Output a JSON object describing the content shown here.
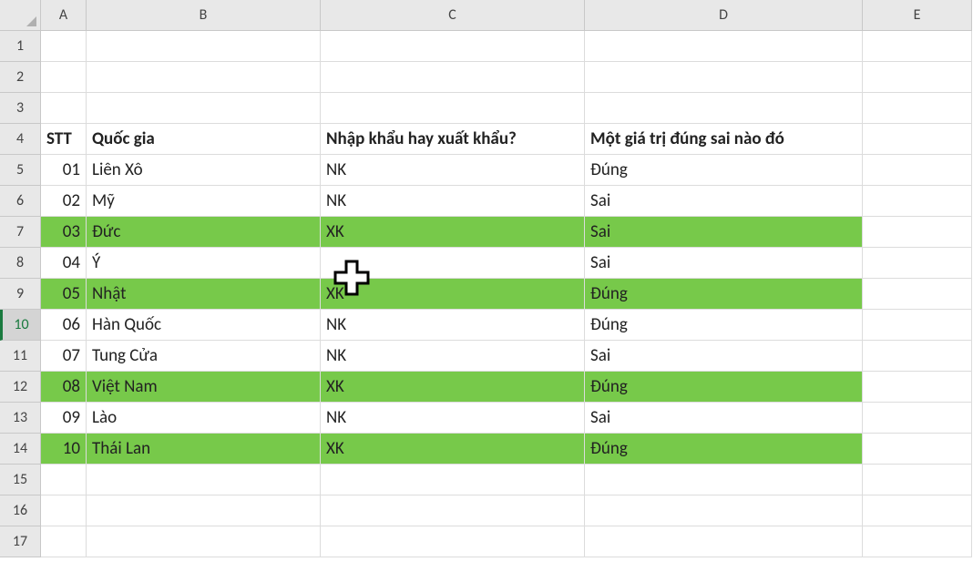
{
  "columns": [
    "A",
    "B",
    "C",
    "D",
    "E"
  ],
  "rowNumbers": [
    "1",
    "2",
    "3",
    "4",
    "5",
    "6",
    "7",
    "8",
    "9",
    "10",
    "11",
    "12",
    "13",
    "14",
    "15",
    "16",
    "17"
  ],
  "selectedRow": 10,
  "header": {
    "stt": "STT",
    "quocGia": "Quốc gia",
    "nhapXuat": "Nhập khẩu hay xuất khẩu?",
    "dungSai": "Một giá trị đúng sai nào đó"
  },
  "rows": [
    {
      "r": 5,
      "stt": "01",
      "quocGia": "Liên Xô",
      "nx": "NK",
      "ds": "Đúng",
      "hl": false
    },
    {
      "r": 6,
      "stt": "02",
      "quocGia": "Mỹ",
      "nx": "NK",
      "ds": "Sai",
      "hl": false
    },
    {
      "r": 7,
      "stt": "03",
      "quocGia": "Đức",
      "nx": "XK",
      "ds": "Sai",
      "hl": true
    },
    {
      "r": 8,
      "stt": "04",
      "quocGia": "Ý",
      "nx": "",
      "ds": "Sai",
      "hl": false
    },
    {
      "r": 9,
      "stt": "05",
      "quocGia": "Nhật",
      "nx": "XK",
      "ds": "Đúng",
      "hl": true
    },
    {
      "r": 10,
      "stt": "06",
      "quocGia": "Hàn Quốc",
      "nx": "NK",
      "ds": "Đúng",
      "hl": false
    },
    {
      "r": 11,
      "stt": "07",
      "quocGia": "Tung Cửa",
      "nx": "NK",
      "ds": "Sai",
      "hl": false
    },
    {
      "r": 12,
      "stt": "08",
      "quocGia": "Việt Nam",
      "nx": "XK",
      "ds": "Đúng",
      "hl": true
    },
    {
      "r": 13,
      "stt": "09",
      "quocGia": "Lào",
      "nx": "NK",
      "ds": "Sai",
      "hl": false
    },
    {
      "r": 14,
      "stt": "10",
      "quocGia": "Thái Lan",
      "nx": "XK",
      "ds": "Đúng",
      "hl": true
    }
  ],
  "colors": {
    "highlight": "#77c94a",
    "headerBg": "#e8e8e8",
    "gridLine": "#dcdcdc"
  }
}
